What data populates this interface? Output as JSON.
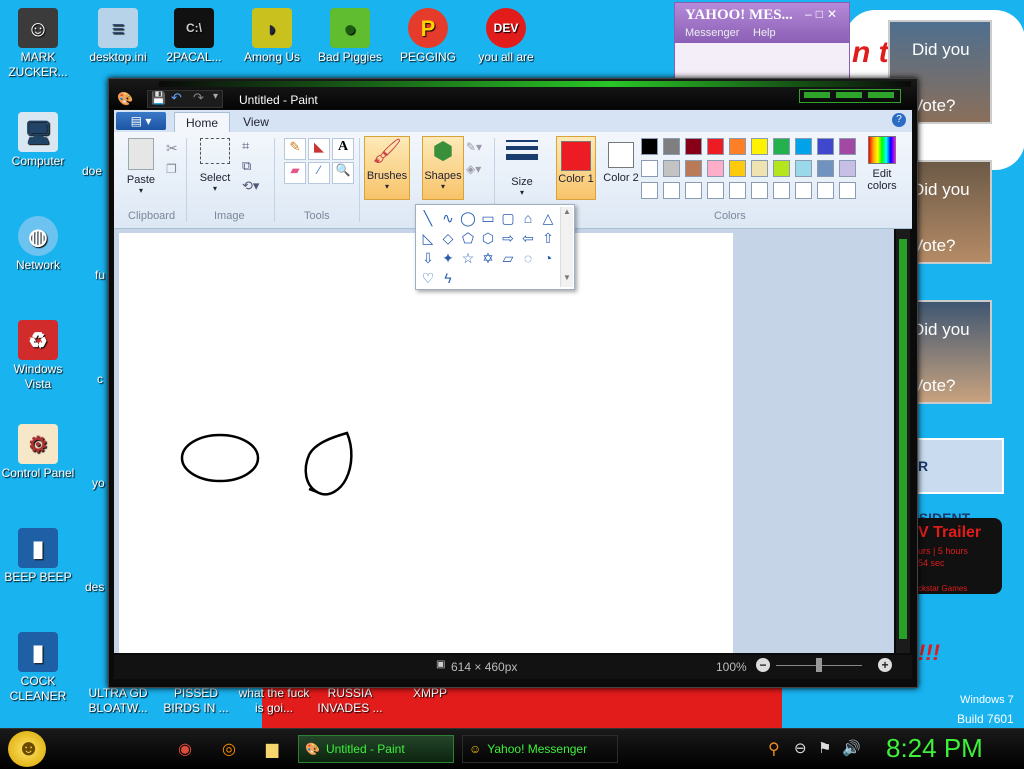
{
  "desktop": {
    "icons": [
      {
        "label": "MARK ZUCKER...",
        "icon": "person-icon",
        "col": 0
      },
      {
        "label": "Computer",
        "icon": "computer-icon"
      },
      {
        "label": "Network",
        "icon": "network-icon"
      },
      {
        "label": "Windows Vista",
        "icon": "recycle-bin-icon"
      },
      {
        "label": "Control Panel",
        "icon": "control-panel-icon"
      },
      {
        "label": "BEEP BEEP",
        "icon": "file-icon"
      },
      {
        "label": "COCK CLEANER",
        "icon": "file-icon"
      }
    ],
    "top_icons": [
      {
        "label": "desktop.ini",
        "icon": "settings-file-icon"
      },
      {
        "label": "2PACAL...",
        "icon": "cmd-icon"
      },
      {
        "label": "Among Us",
        "icon": "among-us-icon"
      },
      {
        "label": "Bad Piggies",
        "icon": "bad-piggies-icon"
      },
      {
        "label": "PEGGING",
        "icon": "pegging-icon"
      },
      {
        "label": "you all are",
        "icon": "dev-cpp-icon"
      }
    ],
    "bottom_labels": [
      "ULTRA GD BLOATW...",
      "PISSED BIRDS IN ...",
      "what the fuck is goi...",
      "RUSSIA INVADES ...",
      "XMPP"
    ],
    "partial_labels": [
      "doe",
      "fu",
      "c",
      "yo",
      "des"
    ],
    "windows_version": "Windows 7",
    "build": "Build 7601",
    "ad_texts": [
      "Did you",
      "Vote?",
      "Did you",
      "Vote?",
      "Did you",
      "Vote?",
      "R PRESIDENT",
      "V Trailer",
      "urs | 5 hours",
      "54 sec",
      "ckstar Games",
      "n t"
    ]
  },
  "yahoo": {
    "title": "YAHOO! MES...",
    "menu": [
      "Messenger",
      "Help"
    ]
  },
  "paint": {
    "title": "Untitled - Paint",
    "tabs": [
      "Home",
      "View"
    ],
    "groups": {
      "clipboard": "Clipboard",
      "image": "Image",
      "tools": "Tools",
      "colors": "Colors"
    },
    "buttons": {
      "paste": "Paste",
      "select": "Select",
      "brushes": "Brushes",
      "shapes": "Shapes",
      "size": "Size",
      "color1": "Color 1",
      "color2": "Color 2",
      "edit_colors": "Edit colors"
    },
    "status": {
      "dimensions": "614 × 460px",
      "zoom": "100%"
    },
    "palette_colors": [
      "#000000",
      "#7f7f7f",
      "#880015",
      "#ed1c24",
      "#ff7f27",
      "#fff200",
      "#22b14c",
      "#00a2e8",
      "#3f48cc",
      "#a349a4",
      "#ffffff",
      "#c3c3c3",
      "#b97a57",
      "#ffaec9",
      "#ffc90e",
      "#efe4b0",
      "#b5e61d",
      "#99d9ea",
      "#7092be",
      "#c8bfe7"
    ],
    "color1": "#ed1c24",
    "color2": "#ffffff"
  },
  "taskbar": {
    "buttons": [
      "Untitled - Paint",
      "Yahoo! Messenger"
    ],
    "clock": "8:24 PM"
  }
}
